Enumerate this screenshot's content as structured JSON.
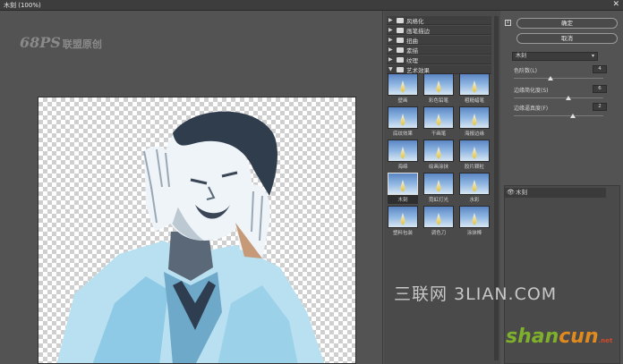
{
  "window": {
    "title": "木刻 (100%)",
    "close": "✕"
  },
  "logo": {
    "mark": "68PS",
    "text": "联盟原创"
  },
  "gallery": {
    "folders": [
      {
        "label": "风格化",
        "expanded": false
      },
      {
        "label": "画笔描边",
        "expanded": false
      },
      {
        "label": "扭曲",
        "expanded": false
      },
      {
        "label": "素描",
        "expanded": false
      },
      {
        "label": "纹理",
        "expanded": false
      },
      {
        "label": "艺术效果",
        "expanded": true
      }
    ],
    "thumbs": [
      "壁画",
      "彩色铅笔",
      "粗糙蜡笔",
      "底纹效果",
      "干画笔",
      "海报边缘",
      "海绵",
      "绘画涂抹",
      "胶片颗粒",
      "木刻",
      "霓虹灯光",
      "水彩",
      "塑料包装",
      "调色刀",
      "涂抹棒"
    ],
    "selected": "木刻"
  },
  "panel": {
    "ok_label": "确定",
    "cancel_label": "取消",
    "toggle_icon": "⇕",
    "filter_select": "木刻",
    "params": [
      {
        "label": "色阶数(L)",
        "value": "4",
        "level": 0.4
      },
      {
        "label": "边缘简化度(S)",
        "value": "6",
        "level": 0.6
      },
      {
        "label": "边缘逼真度(F)",
        "value": "2",
        "level": 0.66
      }
    ],
    "layer": {
      "eye": "👁",
      "name": "木刻"
    }
  },
  "watermarks": {
    "main": "三联网 3LIAN.COM",
    "brand_a": "shan",
    "brand_b": "cun",
    "brand_suffix": ".net"
  }
}
